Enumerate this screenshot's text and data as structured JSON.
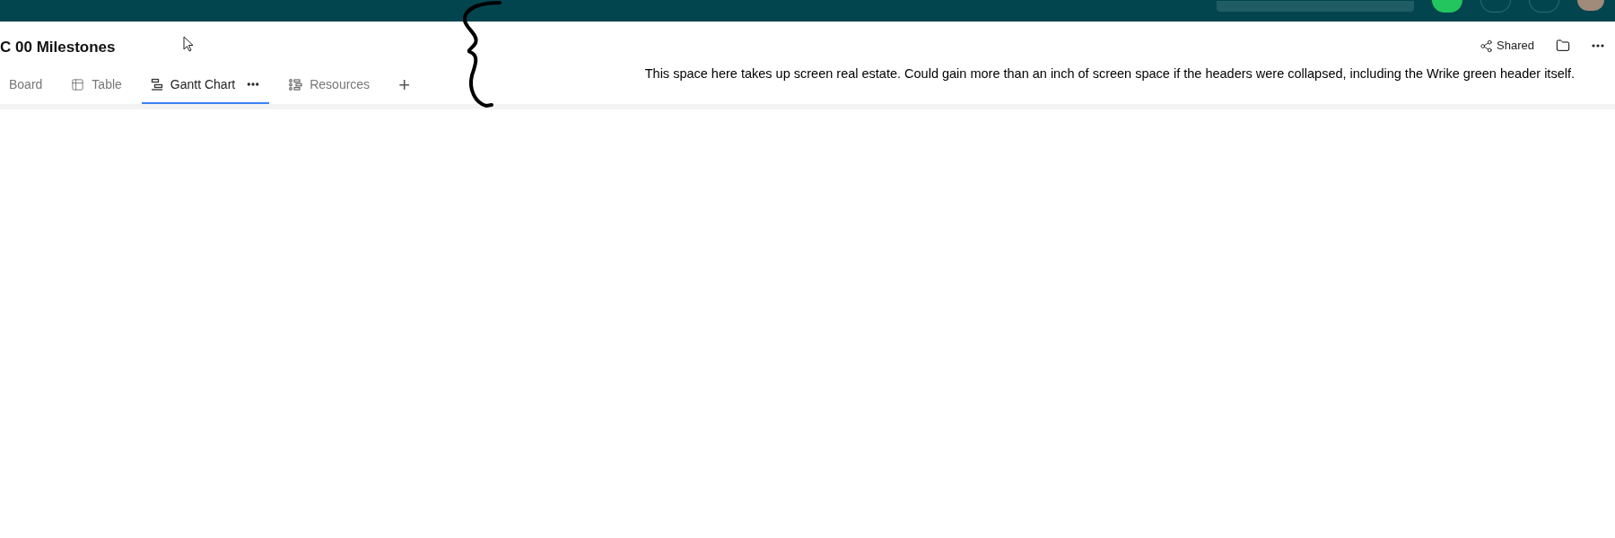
{
  "page": {
    "title": "C 00 Milestones"
  },
  "actions": [
    {
      "kind": "share",
      "label": "Shared"
    },
    {
      "kind": "folder"
    },
    {
      "kind": "more"
    }
  ],
  "tabs": [
    {
      "label": "Board",
      "kind": "plain",
      "selected": false,
      "menu": false
    },
    {
      "label": "Table",
      "kind": "table",
      "selected": false,
      "menu": false
    },
    {
      "label": "Gantt Chart",
      "kind": "gantt",
      "selected": true,
      "menu": true
    },
    {
      "label": "Resources",
      "kind": "resources",
      "selected": false,
      "menu": false
    },
    {
      "label": "+",
      "kind": "add",
      "selected": false,
      "menu": false
    }
  ],
  "annotation": {
    "text": "This space here takes up screen real estate.  Could gain more than an inch of screen space if the headers were collapsed, including the Wrike green header itself."
  }
}
